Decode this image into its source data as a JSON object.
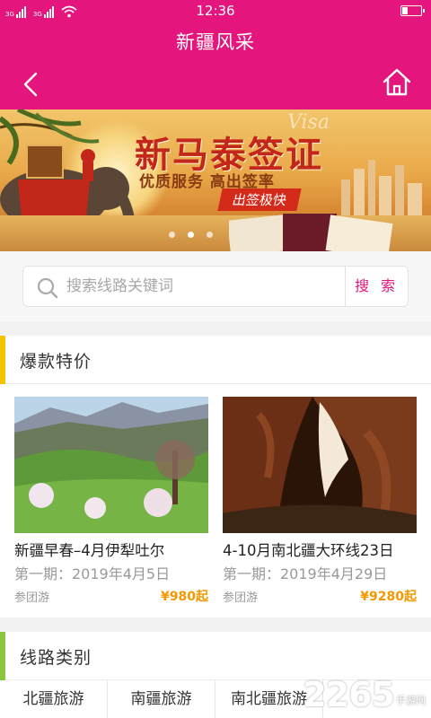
{
  "status_bar": {
    "time": "12:36",
    "signal_tag": "3G",
    "signal_label": "R"
  },
  "header": {
    "title": "新疆风采",
    "back_icon": "chevron-left-icon",
    "home_icon": "home-icon"
  },
  "banner": {
    "headline": "新马泰签证",
    "visa_text": "Visa",
    "subline": "优质服务 高出签率",
    "tag": "出签极快"
  },
  "search": {
    "placeholder": "搜索线路关键词",
    "button_label": "搜 索"
  },
  "hot_deals": {
    "title": "爆款特价",
    "accent_color": "#f5c400",
    "items": [
      {
        "name": "新疆早春–4月伊犁吐尔",
        "date": "第一期：2019年4月5日",
        "type": "参团游",
        "price": "¥980起"
      },
      {
        "name": "4-10月南北疆大环线23日",
        "date": "第一期：2019年4月29日",
        "type": "参团游",
        "price": "¥9280起"
      }
    ]
  },
  "route_categories": {
    "title": "线路类别",
    "accent_color": "#8cc63f",
    "items": [
      "北疆旅游",
      "南疆旅游",
      "南北疆旅游",
      ""
    ]
  },
  "watermark": {
    "logo": "2265",
    "site": "手游网"
  },
  "colors": {
    "brand": "#e4157c",
    "price": "#f39800"
  }
}
